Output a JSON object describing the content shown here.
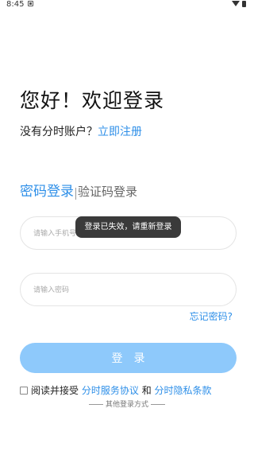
{
  "status_bar": {
    "time": "8:45",
    "notification_icon": "notification-icon",
    "wifi_icon": "wifi-icon",
    "battery_icon": "battery-icon"
  },
  "greeting": "您好！欢迎登录",
  "signup": {
    "prompt": "没有分时账户？",
    "link": "立即注册"
  },
  "tabs": [
    {
      "label": "密码登录",
      "active": true
    },
    {
      "label": "验证码登录",
      "active": false
    }
  ],
  "phone_field": {
    "placeholder": "请输入手机号",
    "value": ""
  },
  "password_field": {
    "placeholder": "请输入密码",
    "value": ""
  },
  "forgot_password": "忘记密码?",
  "login_button": "登录",
  "agreement": {
    "checked": false,
    "prefix": "阅读并接受",
    "service_link": "分时服务协议",
    "conjunction": "和",
    "privacy_link": "分时隐私条款"
  },
  "other_login": "其他登录方式",
  "toast": "登录已失效，请重新登录",
  "colors": {
    "accent": "#2e8fe8",
    "button": "#8ec9fb",
    "toast_bg": "#3a3a3a"
  }
}
